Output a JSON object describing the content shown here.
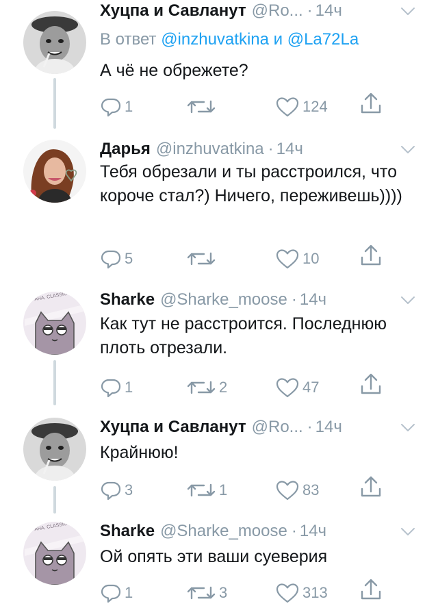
{
  "tweets": [
    {
      "name": "Хуцпа и Савланут",
      "handle": "@Ro...",
      "time": "14ч",
      "reply_prefix": "В ответ",
      "reply_mention1": "@inzhuvatkina",
      "reply_and": "и",
      "reply_mention2": "@La72La",
      "text": "А чё не обрежете?",
      "replies": "1",
      "retweets": "",
      "likes": "124"
    },
    {
      "name": "Дарья",
      "handle": "@inzhuvatkina",
      "time": "14ч",
      "text": "Тебя обрезали и ты расстроился, что короче стал?) Ничего, переживешь))))",
      "replies": "5",
      "retweets": "",
      "likes": "10"
    },
    {
      "name": "Sharke",
      "handle": "@Sharke_moose",
      "time": "14ч",
      "text": "Как тут не расстроится. Последнюю плоть отрезали.",
      "replies": "1",
      "retweets": "2",
      "likes": "47"
    },
    {
      "name": "Хуцпа и Савланут",
      "handle": "@Ro...",
      "time": "14ч",
      "text": "Крайнюю!",
      "replies": "3",
      "retweets": "1",
      "likes": "83"
    },
    {
      "name": "Sharke",
      "handle": "@Sharke_moose",
      "time": "14ч",
      "text": "Ой опять эти ваши суеверия",
      "replies": "1",
      "retweets": "3",
      "likes": "313"
    }
  ],
  "avatar_text": "AHA, CLASSIC",
  "colors": {
    "text": "#14171a",
    "muted": "#8899a6",
    "link": "#1da1f2",
    "thread": "#cfd9de"
  },
  "icons": [
    "reply-icon",
    "retweet-icon",
    "like-icon",
    "share-icon",
    "chevron-down-icon"
  ]
}
